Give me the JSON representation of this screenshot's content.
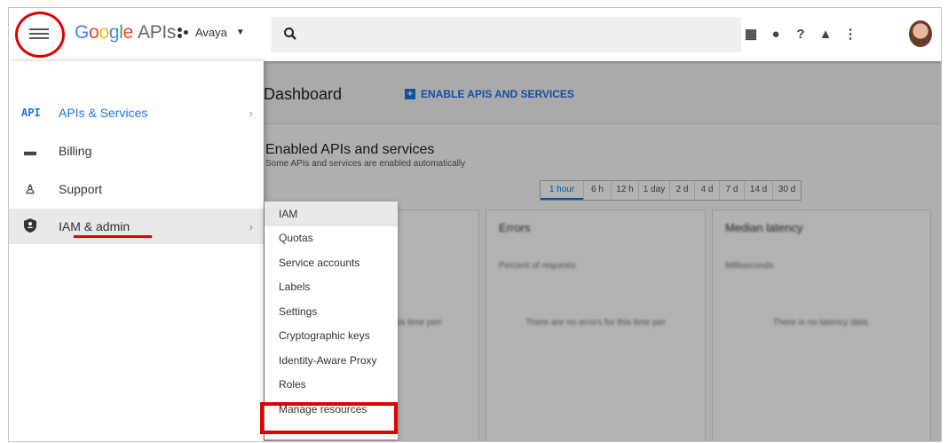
{
  "header": {
    "menu_icon": "hamburger-menu-icon",
    "logo_parts": [
      "G",
      "o",
      "o",
      "g",
      "l",
      "e"
    ],
    "apis_label": "APIs",
    "project_name": "Avaya",
    "project_icon": "project-dots-icon",
    "search_icon": "search-icon",
    "toolbar_icons": [
      "gift-icon",
      "feedback-icon",
      "help-icon",
      "notifications-icon",
      "more-vert-icon"
    ]
  },
  "dashboard": {
    "title": "Dashboard",
    "enable_button": "ENABLE APIS AND SERVICES",
    "section_title": "Enabled APIs and services",
    "section_subtitle": "Some APIs and services are enabled automatically",
    "time_ranges": [
      "1 hour",
      "6 h",
      "12 h",
      "1 day",
      "2 d",
      "4 d",
      "7 d",
      "14 d",
      "30 d"
    ],
    "cards": [
      {
        "title": "",
        "subtitle": "",
        "message": "There are no traffic for this time peri"
      },
      {
        "title": "Errors",
        "subtitle": "Percent of requests",
        "message": "There are no errors for this time per"
      },
      {
        "title": "Median latency",
        "subtitle": "Milliseconds",
        "message": "There is no latency data."
      }
    ]
  },
  "sidenav": {
    "items": [
      {
        "label": "APIs & Services",
        "icon": "api-icon",
        "icon_text": "API",
        "chevron": "›"
      },
      {
        "label": "Billing",
        "icon": "billing-icon"
      },
      {
        "label": "Support",
        "icon": "support-icon"
      },
      {
        "label": "IAM & admin",
        "icon": "shield-icon",
        "chevron": "›"
      }
    ]
  },
  "submenu": {
    "items": [
      "IAM",
      "Quotas",
      "Service accounts",
      "Labels",
      "Settings",
      "Cryptographic keys",
      "Identity-Aware Proxy",
      "Roles",
      "Manage resources"
    ]
  },
  "colors": {
    "accent": "#1a73e8",
    "highlight": "#e00000"
  }
}
